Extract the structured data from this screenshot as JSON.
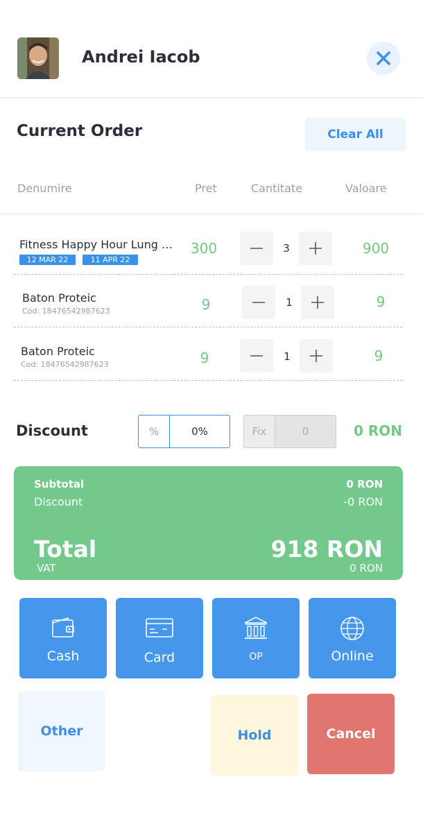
{
  "header": {
    "user_name": "Andrei Iacob"
  },
  "order": {
    "title": "Current Order",
    "clear_all_label": "Clear All",
    "columns": {
      "name": "Denumire",
      "price": "Pret",
      "quantity": "Cantitate",
      "value": "Valoare"
    },
    "items": [
      {
        "name": "Fitness Happy Hour  Lung  …",
        "start_date": "12 MAR 22",
        "end_date": "11 APR 22",
        "price": "300",
        "quantity": "3",
        "value": "900"
      },
      {
        "name": "Baton Proteic",
        "code": "Cod: 18476542987623",
        "price": "9",
        "quantity": "1",
        "value": "9"
      },
      {
        "name": "Baton Proteic",
        "code": "Cod: 18476542987623",
        "price": "9",
        "quantity": "1",
        "value": "9"
      }
    ]
  },
  "discount": {
    "label": "Discount",
    "percent_symbol": "%",
    "percent_value": "0%",
    "fix_label": "Fix",
    "fix_value": "0",
    "amount": "0 RON"
  },
  "summary": {
    "subtotal_label": "Subtotal",
    "subtotal_value": "0 RON",
    "discount_label": "Discount",
    "discount_value": "-0 RON",
    "total_label": "Total",
    "total_value": "918 RON",
    "vat_label": "VAT",
    "vat_value": "0 RON"
  },
  "payment": {
    "cash": "Cash",
    "card": "Card",
    "op": "OP",
    "online": "Online",
    "other": "Other",
    "hold": "Hold",
    "cancel": "Cancel"
  },
  "colors": {
    "accent_blue": "#4597ec",
    "green": "#72c98b",
    "cancel_red": "#e0766f",
    "hold_yellow": "#fef7de"
  }
}
